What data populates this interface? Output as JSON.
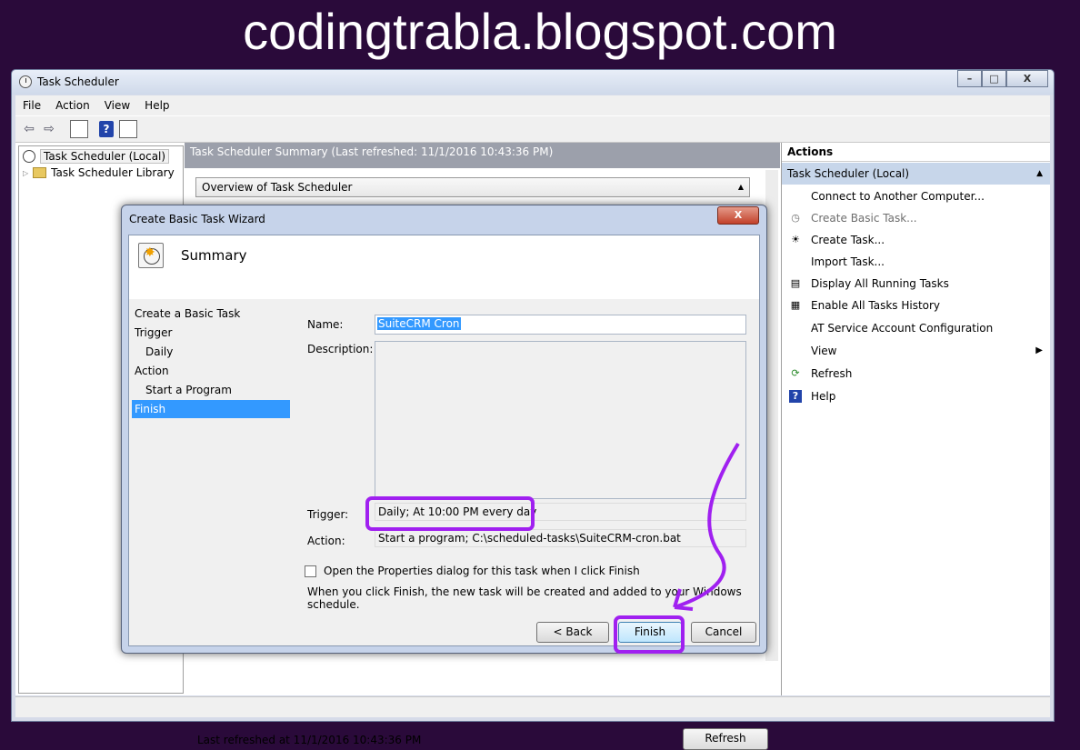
{
  "banner": {
    "text": "codingtrabla.blogspot.com"
  },
  "window": {
    "title": "Task Scheduler",
    "caption": {
      "min": "–",
      "max": "□",
      "close": "X"
    }
  },
  "menu": [
    "File",
    "Action",
    "View",
    "Help"
  ],
  "tree": {
    "root": "Task Scheduler (Local)",
    "child": "Task Scheduler Library"
  },
  "middle": {
    "header": "Task Scheduler Summary (Last refreshed: 11/1/2016 10:43:36 PM)",
    "overview": "Overview of Task Scheduler",
    "footer": "Last refreshed at 11/1/2016 10:43:36 PM",
    "refresh_button": "Refresh"
  },
  "actions": {
    "header": "Actions",
    "section": "Task Scheduler (Local)",
    "items": [
      {
        "label": "Connect to Another Computer...",
        "icon": ""
      },
      {
        "label": "Create Basic Task...",
        "icon": "clock-icon",
        "disabled": true
      },
      {
        "label": "Create Task...",
        "icon": "new-task-icon"
      },
      {
        "label": "Import Task...",
        "icon": ""
      },
      {
        "label": "Display All Running Tasks",
        "icon": "list-icon"
      },
      {
        "label": "Enable All Tasks History",
        "icon": "history-icon"
      },
      {
        "label": "AT Service Account Configuration",
        "icon": ""
      },
      {
        "label": "View",
        "icon": "",
        "submenu": true
      },
      {
        "label": "Refresh",
        "icon": "refresh-icon"
      },
      {
        "label": "Help",
        "icon": "help-icon"
      }
    ]
  },
  "dialog": {
    "title": "Create Basic Task Wizard",
    "close": "X",
    "heading": "Summary",
    "steps": [
      {
        "label": "Create a Basic Task",
        "sub": false
      },
      {
        "label": "Trigger",
        "sub": false
      },
      {
        "label": "Daily",
        "sub": true
      },
      {
        "label": "Action",
        "sub": false
      },
      {
        "label": "Start a Program",
        "sub": true
      },
      {
        "label": "Finish",
        "sub": false,
        "active": true
      }
    ],
    "name_label": "Name:",
    "name_value": "SuiteCRM Cron",
    "description_label": "Description:",
    "description_value": "",
    "trigger_label": "Trigger:",
    "trigger_value": "Daily; At 10:00 PM every day",
    "action_label": "Action:",
    "action_value": "Start a program; C:\\scheduled-tasks\\SuiteCRM-cron.bat",
    "checkbox_label": "Open the Properties dialog for this task when I click Finish",
    "checkbox_checked": false,
    "info": "When you click Finish, the new task will be created and added to your Windows schedule.",
    "buttons": {
      "back": "< Back",
      "finish": "Finish",
      "cancel": "Cancel"
    }
  },
  "colors": {
    "highlight": "#a020f0",
    "selection": "#3399ff",
    "background": "#2a0a3a"
  }
}
